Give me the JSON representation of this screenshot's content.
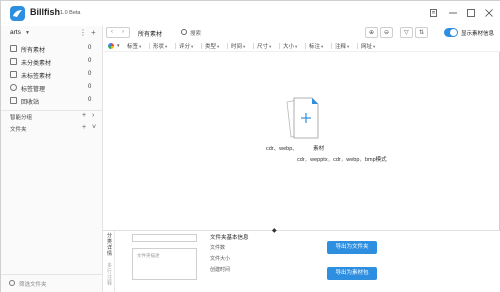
{
  "app": {
    "name": "Billfish",
    "version": "1.0 Beta"
  },
  "window_controls": [
    "restore-icon",
    "minimize-icon",
    "maximize-icon",
    "close-icon"
  ],
  "sidebar": {
    "library": "arts",
    "items": [
      {
        "label": "所有素材",
        "count": "0",
        "icon": "all-items-icon"
      },
      {
        "label": "未分类素材",
        "count": "0",
        "icon": "unclassified-icon"
      },
      {
        "label": "未标签素材",
        "count": "0",
        "icon": "untagged-icon"
      },
      {
        "label": "标签管理",
        "count": "0",
        "icon": "tag-manage-icon"
      },
      {
        "label": "回收站",
        "count": "0",
        "icon": "trash-icon"
      }
    ],
    "sections": {
      "smart": "智能分组",
      "folders": "文件夹"
    },
    "search_placeholder": "筛选文件夹"
  },
  "toolbar": {
    "title": "所有素材",
    "search_placeholder": "搜索",
    "toggle_label": "显示素材信息",
    "toggle_on": true
  },
  "filters": [
    "标签",
    "形状",
    "评分",
    "类型",
    "时间",
    "尺寸",
    "大小",
    "标注",
    "注释",
    "网址"
  ],
  "empty_state": {
    "line1": "cdr、webp、",
    "line1_tail": "素材",
    "line2": [
      "cdr",
      "wepptx",
      "cdr",
      "webp",
      "bmp模式"
    ]
  },
  "inspector": {
    "tabs": [
      "分",
      "类",
      "详",
      "情"
    ],
    "tabs_off": [
      "多",
      "行",
      "注",
      "释"
    ],
    "desc_placeholder": "文件夹描述",
    "heading": "文件夹基本信息",
    "fields": [
      "文件数",
      "文件大小",
      "创建时间"
    ],
    "btn_export_folder": "导出为文件夹",
    "btn_export_assets": "导出为素材包"
  },
  "colors": {
    "accent": "#2e8fe0"
  }
}
